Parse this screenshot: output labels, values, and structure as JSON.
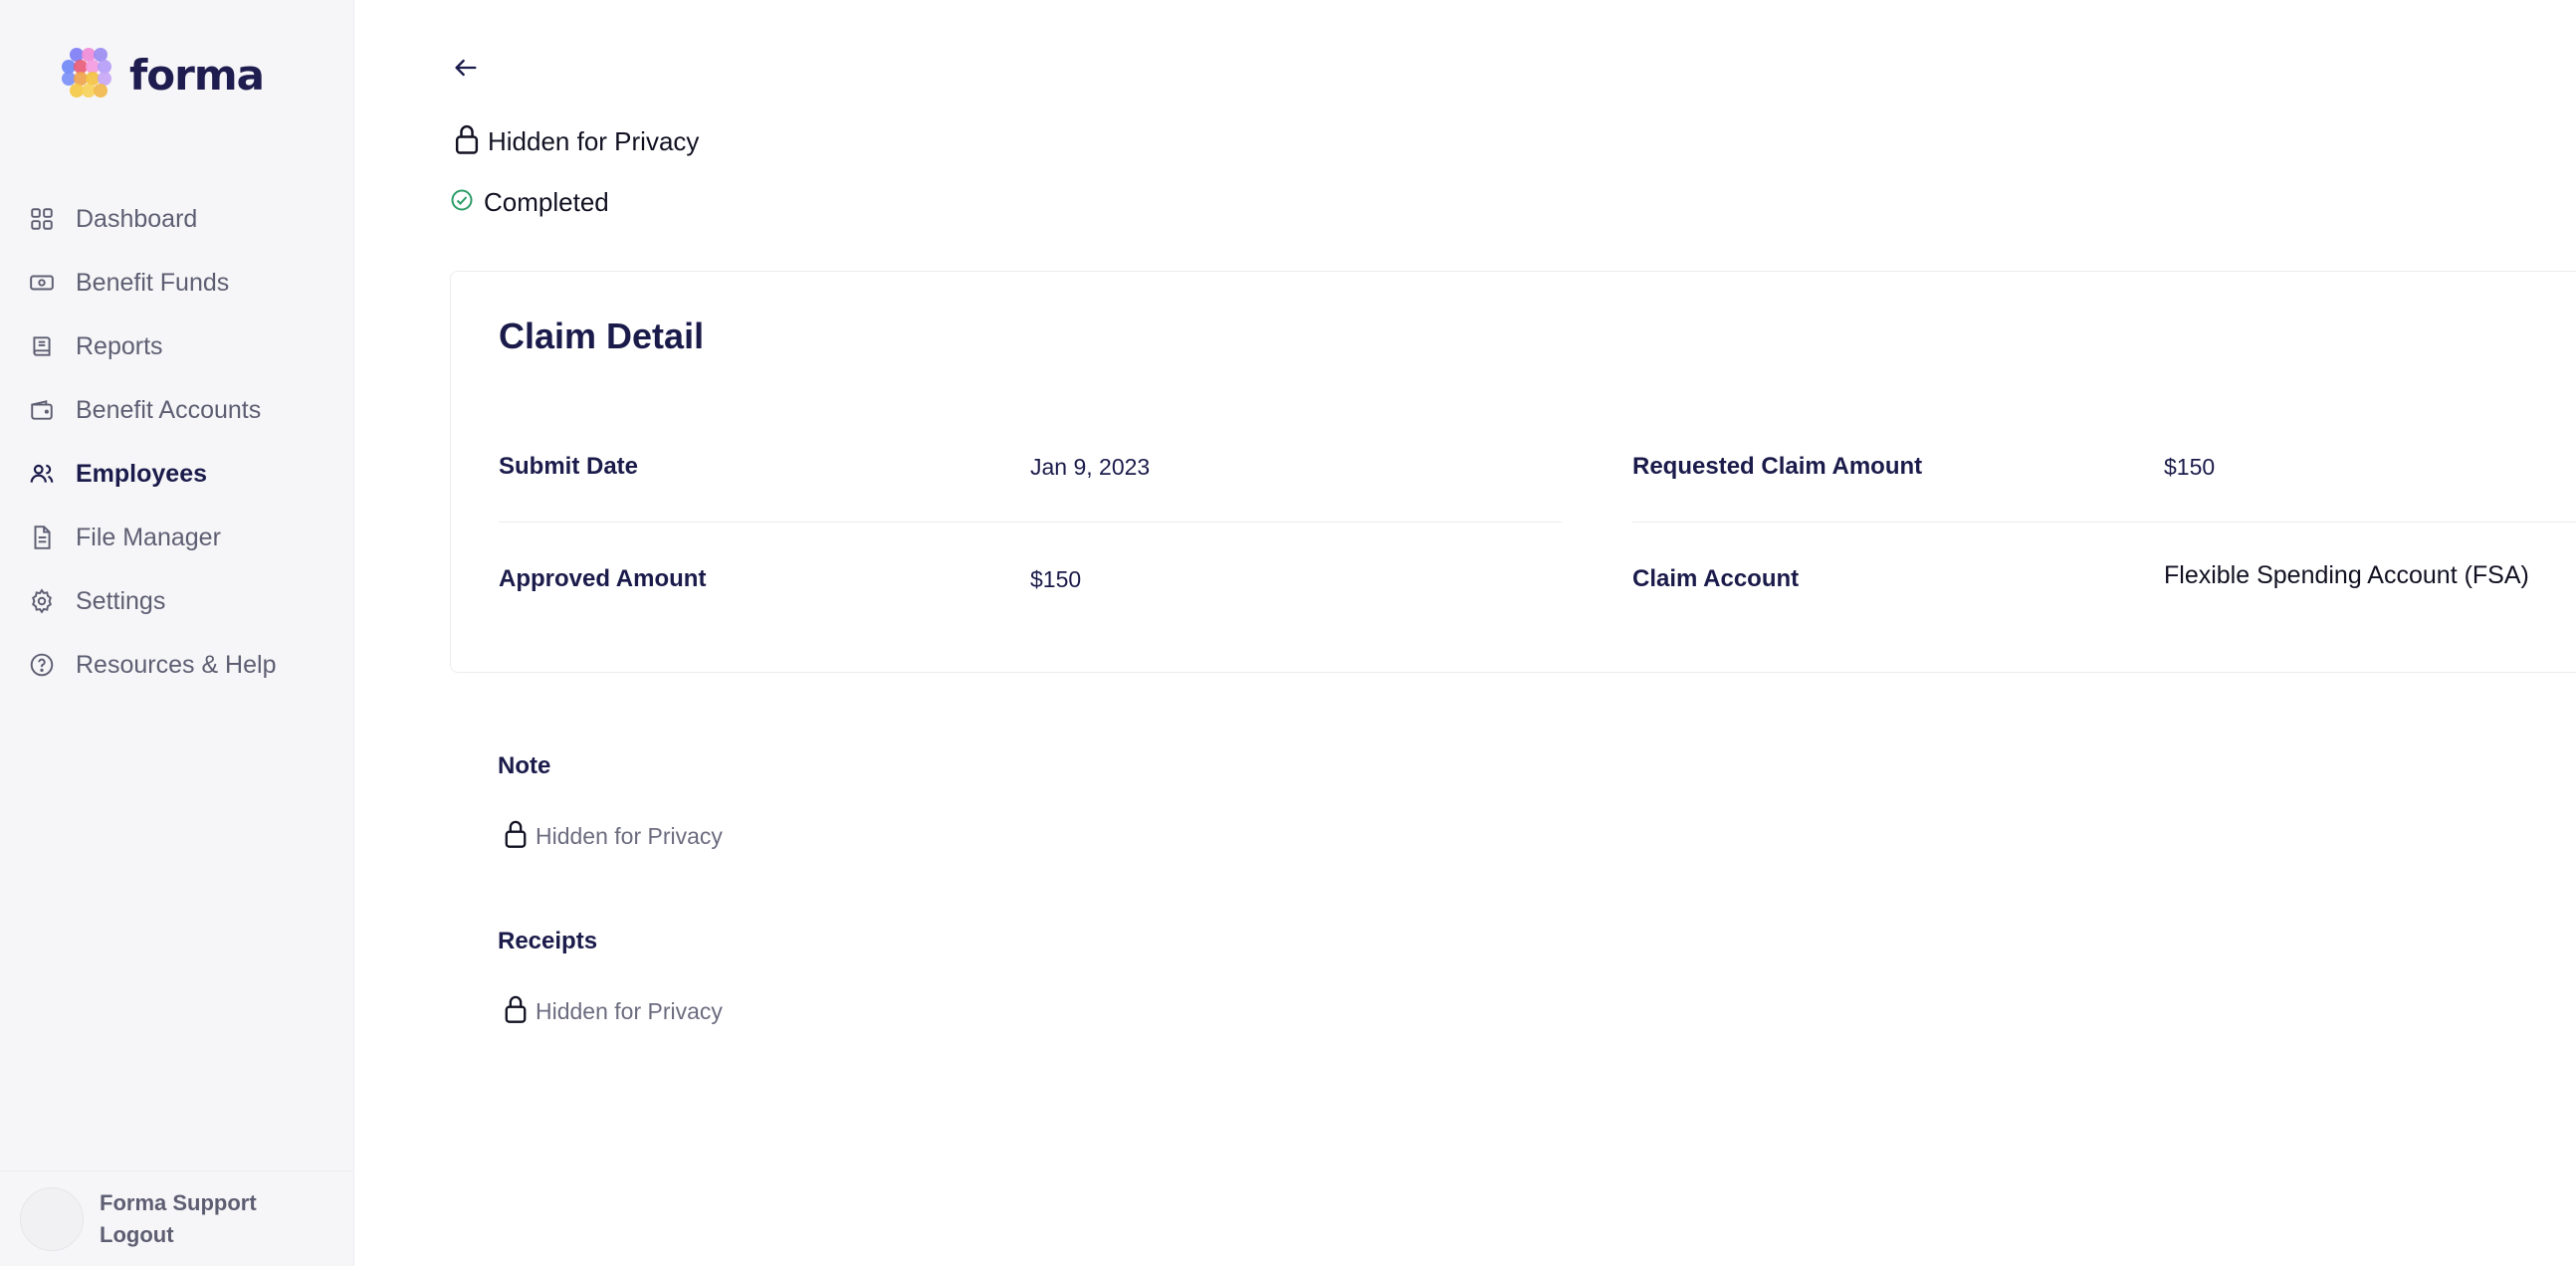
{
  "brand": {
    "name": "forma"
  },
  "sidebar": {
    "items": [
      {
        "label": "Dashboard",
        "icon": "dashboard-grid-icon"
      },
      {
        "label": "Benefit Funds",
        "icon": "cash-icon"
      },
      {
        "label": "Reports",
        "icon": "book-icon"
      },
      {
        "label": "Benefit Accounts",
        "icon": "wallet-icon"
      },
      {
        "label": "Employees",
        "icon": "users-icon",
        "active": true
      },
      {
        "label": "File Manager",
        "icon": "file-icon"
      },
      {
        "label": "Settings",
        "icon": "gear-icon"
      },
      {
        "label": "Resources & Help",
        "icon": "help-circle-icon"
      }
    ],
    "user": {
      "name": "Forma Support",
      "logout": "Logout"
    }
  },
  "header": {
    "privacy_title": "Hidden for Privacy",
    "status": "Completed"
  },
  "claim": {
    "title": "Claim Detail",
    "fields": {
      "submit_date": {
        "label": "Submit Date",
        "value": "Jan 9, 2023"
      },
      "requested_amount": {
        "label": "Requested Claim Amount",
        "value": "$150"
      },
      "approved_amount": {
        "label": "Approved Amount",
        "value": "$150"
      },
      "claim_account": {
        "label": "Claim Account",
        "value": "Flexible Spending Account (FSA)"
      }
    }
  },
  "note": {
    "label": "Note",
    "value": "Hidden for Privacy"
  },
  "receipts": {
    "label": "Receipts",
    "value": "Hidden for Privacy"
  },
  "colors": {
    "text_primary": "#1b1b4b",
    "text_muted": "#5e5e73",
    "status_green": "#2e9e6a",
    "sidebar_bg": "#f6f6f8"
  }
}
